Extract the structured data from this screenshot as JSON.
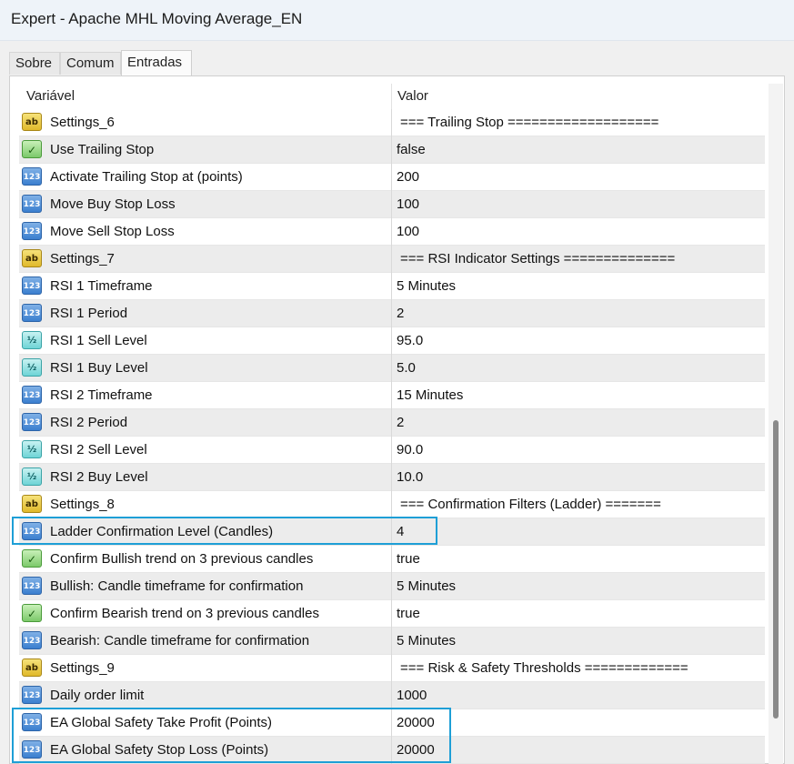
{
  "window": {
    "title": "Expert - Apache MHL Moving Average_EN"
  },
  "tabs": [
    {
      "label": "Sobre",
      "active": false
    },
    {
      "label": "Comum",
      "active": false
    },
    {
      "label": "Entradas",
      "active": true
    }
  ],
  "grid": {
    "columns": {
      "variable": "Variável",
      "value": "Valor"
    },
    "rows": [
      {
        "icon": "string-icon",
        "icon_text": "ab",
        "name": "Settings_6",
        "value": "=== Trailing Stop ==================="
      },
      {
        "icon": "bool-icon",
        "icon_text": "✓",
        "name": "Use Trailing Stop",
        "value": "false"
      },
      {
        "icon": "integer-icon",
        "icon_text": "123",
        "name": "Activate Trailing Stop at (points)",
        "value": "200"
      },
      {
        "icon": "integer-icon",
        "icon_text": "123",
        "name": "Move Buy Stop Loss",
        "value": "100"
      },
      {
        "icon": "integer-icon",
        "icon_text": "123",
        "name": "Move Sell Stop Loss",
        "value": "100"
      },
      {
        "icon": "string-icon",
        "icon_text": "ab",
        "name": "Settings_7",
        "value": "=== RSI Indicator Settings =============="
      },
      {
        "icon": "integer-icon",
        "icon_text": "123",
        "name": "RSI 1 Timeframe",
        "value": "5 Minutes"
      },
      {
        "icon": "integer-icon",
        "icon_text": "123",
        "name": "RSI 1 Period",
        "value": "2"
      },
      {
        "icon": "double-icon",
        "icon_text": "½",
        "name": "RSI 1 Sell Level",
        "value": "95.0"
      },
      {
        "icon": "double-icon",
        "icon_text": "½",
        "name": "RSI 1 Buy Level",
        "value": "5.0"
      },
      {
        "icon": "integer-icon",
        "icon_text": "123",
        "name": "RSI 2 Timeframe",
        "value": "15 Minutes"
      },
      {
        "icon": "integer-icon",
        "icon_text": "123",
        "name": "RSI 2 Period",
        "value": "2"
      },
      {
        "icon": "double-icon",
        "icon_text": "½",
        "name": "RSI 2 Sell Level",
        "value": "90.0"
      },
      {
        "icon": "double-icon",
        "icon_text": "½",
        "name": "RSI 2 Buy Level",
        "value": "10.0"
      },
      {
        "icon": "string-icon",
        "icon_text": "ab",
        "name": "Settings_8",
        "value": "=== Confirmation Filters (Ladder) ======="
      },
      {
        "icon": "integer-icon",
        "icon_text": "123",
        "name": "Ladder Confirmation Level (Candles)",
        "value": "4"
      },
      {
        "icon": "bool-icon",
        "icon_text": "✓",
        "name": "Confirm Bullish trend on 3 previous candles",
        "value": "true"
      },
      {
        "icon": "integer-icon",
        "icon_text": "123",
        "name": "Bullish: Candle timeframe for confirmation",
        "value": "5 Minutes"
      },
      {
        "icon": "bool-icon",
        "icon_text": "✓",
        "name": "Confirm Bearish trend on 3 previous candles",
        "value": "true"
      },
      {
        "icon": "integer-icon",
        "icon_text": "123",
        "name": "Bearish: Candle timeframe for confirmation",
        "value": "5 Minutes"
      },
      {
        "icon": "string-icon",
        "icon_text": "ab",
        "name": "Settings_9",
        "value": "=== Risk & Safety Thresholds ============="
      },
      {
        "icon": "integer-icon",
        "icon_text": "123",
        "name": "Daily order limit",
        "value": "1000"
      },
      {
        "icon": "integer-icon",
        "icon_text": "123",
        "name": "EA Global Safety Take Profit (Points)",
        "value": "20000"
      },
      {
        "icon": "integer-icon",
        "icon_text": "123",
        "name": "EA Global Safety Stop Loss (Points)",
        "value": "20000"
      }
    ]
  },
  "colors": {
    "highlight": "#1e9fd6",
    "row_alt": "#ececec",
    "title_bg": "#eef3f9"
  }
}
